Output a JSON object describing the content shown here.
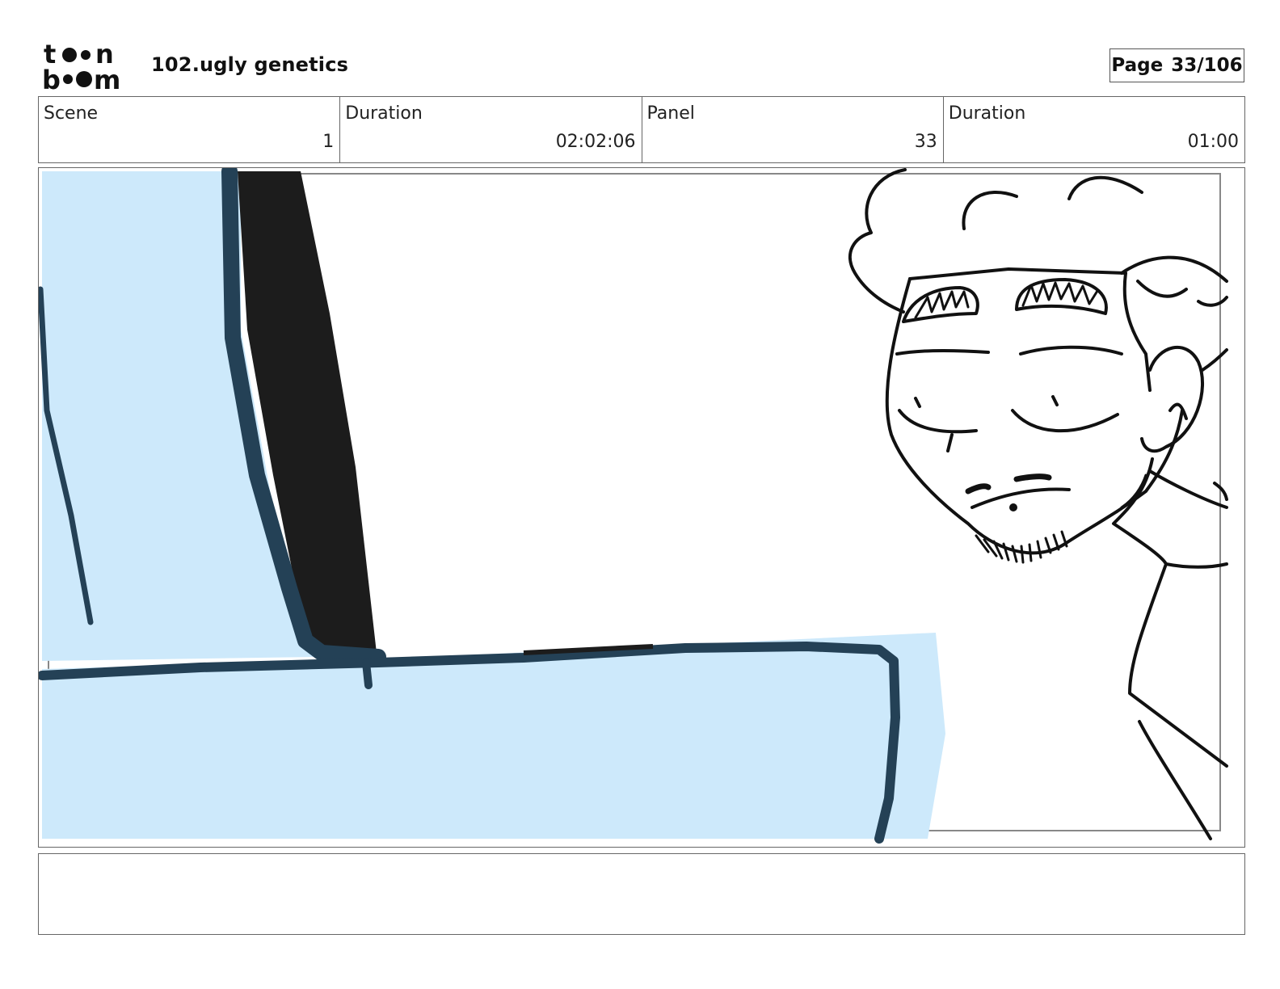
{
  "header": {
    "logo_text": "toonboom",
    "project_title": "102.ugly genetics",
    "page_label": "Page",
    "page_value": "33/106"
  },
  "info": {
    "scene_label": "Scene",
    "scene_value": "1",
    "scene_duration_label": "Duration",
    "scene_duration_value": "02:02:06",
    "panel_label": "Panel",
    "panel_value": "33",
    "panel_duration_label": "Duration",
    "panel_duration_value": "01:00"
  },
  "panel": {
    "colors": {
      "light_blue": "#cde9fb",
      "dark_blue": "#244156",
      "ink": "#111111",
      "black_fill": "#1c1c1c"
    }
  },
  "notes": {
    "text": ""
  }
}
